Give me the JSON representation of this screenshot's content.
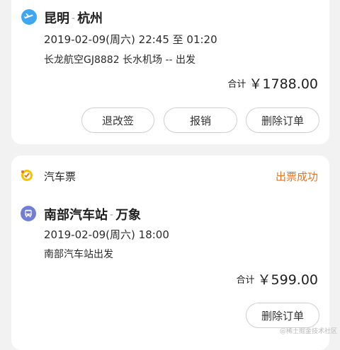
{
  "flight_card": {
    "from": "昆明",
    "separator": "-",
    "to": "杭州",
    "time_line": "2019-02-09(周六) 22:45 至 01:20",
    "detail_line": "长龙航空GJ8882 长水机场 -- 出发",
    "total_label": "合计",
    "total_amount": "￥1788.00",
    "buttons": {
      "reschedule": "退改签",
      "reimburse": "报销",
      "delete": "删除订单"
    },
    "icon": "airplane-icon",
    "icon_color": "#3fa7f0"
  },
  "bus_card": {
    "category_label": "汽车票",
    "status": "出票成功",
    "status_color": "#e8741e",
    "from": "南部汽车站",
    "separator": "-",
    "to": "万象",
    "time_line": "2019-02-09(周六) 18:00",
    "detail_line": "南部汽车站出发",
    "total_label": "合计",
    "total_amount": "￥599.00",
    "buttons": {
      "delete": "删除订单"
    },
    "category_icon": "bus-ticket-icon",
    "route_icon": "bus-icon",
    "route_icon_color": "#6f7fd8"
  },
  "watermark": "@稀土掘金技术社区"
}
